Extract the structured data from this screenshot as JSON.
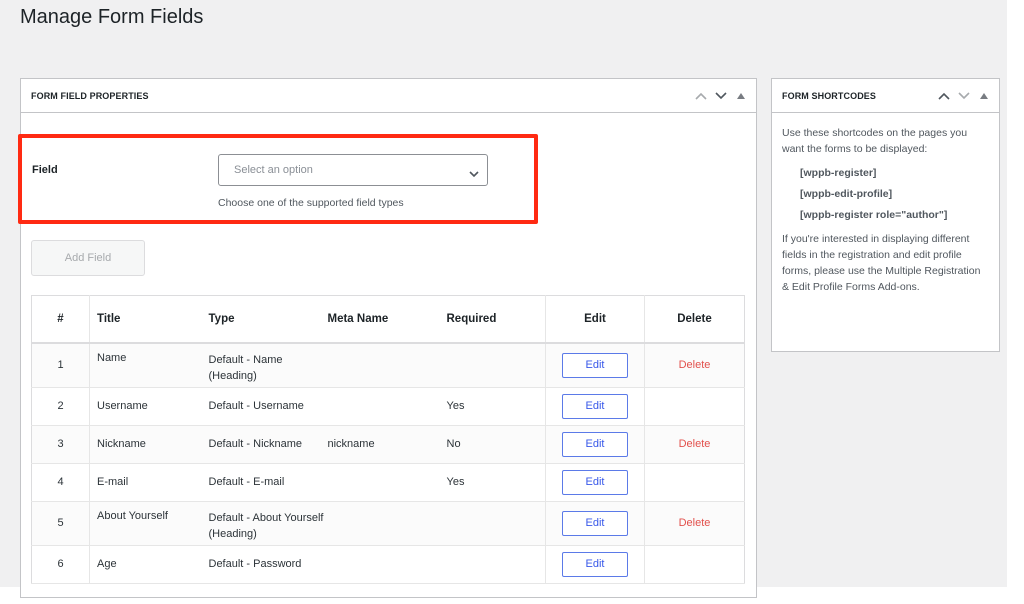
{
  "page": {
    "title": "Manage Form Fields"
  },
  "colors": {
    "highlight": "#ff2a12",
    "edit_button": "#3858e9",
    "delete_link": "#e2504c",
    "background": "#f0f0f1"
  },
  "main_panel": {
    "title": "FORM FIELD PROPERTIES",
    "controls": [
      "chevron-up-icon",
      "chevron-down-icon",
      "triangle-up-icon"
    ],
    "field": {
      "label": "Field",
      "placeholder": "Select an option",
      "description": "Choose one of the supported field types"
    },
    "add_field_label": "Add Field",
    "table": {
      "columns": [
        "#",
        "Title",
        "Type",
        "Meta Name",
        "Required",
        "Edit",
        "Delete"
      ],
      "rows": [
        {
          "num": "1",
          "title": "Name",
          "type": "Default - Name (Heading)",
          "meta": "",
          "required": "",
          "edit": "Edit",
          "delete": "Delete"
        },
        {
          "num": "2",
          "title": "Username",
          "type": "Default - Username",
          "meta": "",
          "required": "Yes",
          "edit": "Edit",
          "delete": ""
        },
        {
          "num": "3",
          "title": "Nickname",
          "type": "Default - Nickname",
          "meta": "nickname",
          "required": "No",
          "edit": "Edit",
          "delete": "Delete"
        },
        {
          "num": "4",
          "title": "E-mail",
          "type": "Default - E-mail",
          "meta": "",
          "required": "Yes",
          "edit": "Edit",
          "delete": ""
        },
        {
          "num": "5",
          "title": "About Yourself",
          "type": "Default - About Yourself (Heading)",
          "meta": "",
          "required": "",
          "edit": "Edit",
          "delete": "Delete"
        },
        {
          "num": "6",
          "title": "Age",
          "type": "Default - Password",
          "meta": "",
          "required": "",
          "edit": "Edit",
          "delete": ""
        }
      ]
    }
  },
  "side_panel": {
    "title": "FORM SHORTCODES",
    "controls": [
      "chevron-up-icon",
      "chevron-down-icon",
      "triangle-up-icon"
    ],
    "intro": "Use these shortcodes on the pages you want the forms to be displayed:",
    "shortcodes": [
      "[wppb-register]",
      "[wppb-edit-profile]",
      "[wppb-register role=\"author\"]"
    ],
    "note": "If you're interested in displaying different fields in the registration and edit profile forms, please use the Multiple Registration & Edit Profile Forms Add-ons."
  }
}
